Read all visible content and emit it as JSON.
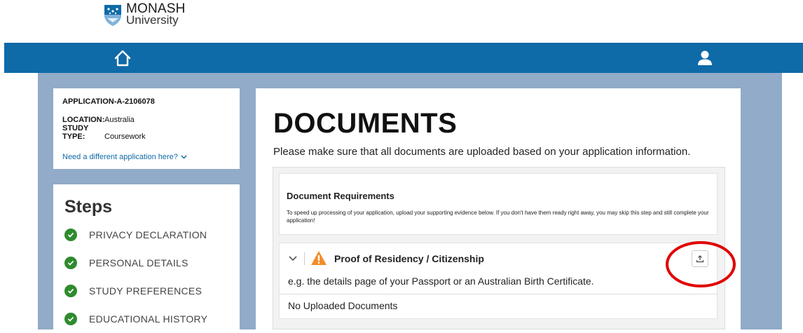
{
  "brand": {
    "name_line1": "MONASH",
    "name_line2": "University"
  },
  "application": {
    "id": "APPLICATION-A-2106078",
    "location_label": "LOCATION:",
    "location_value": "Australia",
    "study_type_label": "STUDY TYPE:",
    "study_type_value": "Coursework",
    "different_link": "Need a different application here?"
  },
  "steps": {
    "title": "Steps",
    "items": [
      {
        "label": "PRIVACY DECLARATION"
      },
      {
        "label": "PERSONAL DETAILS"
      },
      {
        "label": "STUDY PREFERENCES"
      },
      {
        "label": "EDUCATIONAL HISTORY"
      }
    ]
  },
  "documents": {
    "title": "DOCUMENTS",
    "subtitle": "Please make sure that all documents are uploaded based on your application information.",
    "requirements": {
      "title": "Document Requirements",
      "text": "To speed up processing of your application, upload your supporting evidence below. If you don't have them ready right away, you may skip this step and still complete your application!"
    },
    "proof": {
      "title": "Proof of Residency / Citizenship",
      "description": "e.g. the details page of your Passport or an Australian Birth Certificate.",
      "uploaded_status": "No Uploaded Documents"
    }
  },
  "colors": {
    "navbar": "#0f6aa8",
    "background": "#91abc8",
    "step_check": "#2e8b2e",
    "warning": "#f28c28",
    "annotation_circle": "#e00000"
  },
  "icons": {
    "logo": "monash-crest-icon",
    "home": "home-icon",
    "user": "user-icon",
    "check": "check-icon",
    "chevron": "chevron-down-icon",
    "warning": "warning-icon",
    "upload": "upload-icon"
  }
}
